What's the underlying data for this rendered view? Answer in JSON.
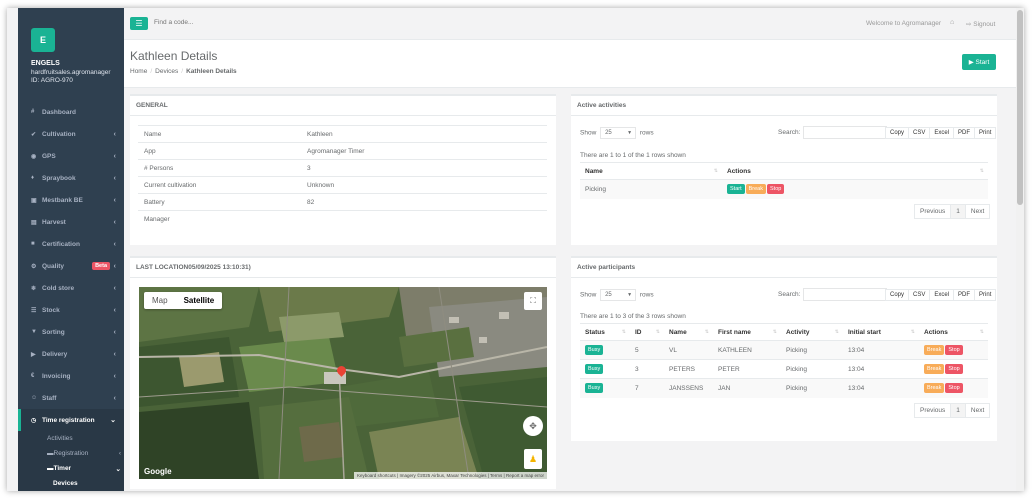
{
  "sidebar": {
    "logo": "E",
    "company": "ENGELS",
    "email": "hardfruitsales.agromanager",
    "id": "ID: AGRO-970",
    "items": [
      {
        "icon": "#",
        "label": "Dashboard"
      },
      {
        "icon": "✔",
        "label": "Cultivation"
      },
      {
        "icon": "◉",
        "label": "GPS"
      },
      {
        "icon": "♦",
        "label": "Spraybook"
      },
      {
        "icon": "▣",
        "label": "Mestbank BE"
      },
      {
        "icon": "▤",
        "label": "Harvest"
      },
      {
        "icon": "■",
        "label": "Certification"
      },
      {
        "icon": "⚙",
        "label": "Quality",
        "badge": "Beta"
      },
      {
        "icon": "❄",
        "label": "Cold store"
      },
      {
        "icon": "☰",
        "label": "Stock"
      },
      {
        "icon": "▼",
        "label": "Sorting"
      },
      {
        "icon": "▶",
        "label": "Delivery"
      },
      {
        "icon": "€",
        "label": "Invoicing"
      },
      {
        "icon": "☺",
        "label": "Staff"
      },
      {
        "icon": "◷",
        "label": "Time registration"
      }
    ],
    "sub": {
      "activities": "Activities",
      "registration": "Registration",
      "timer": "Timer",
      "devices": "Devices"
    }
  },
  "topbar": {
    "search_placeholder": "Find a code...",
    "welcome": "Welcome to Agromanager",
    "signout": "Signout"
  },
  "header": {
    "title": "Kathleen Details",
    "breadcrumb": [
      "Home",
      "Devices",
      "Kathleen Details"
    ],
    "start_label": "Start"
  },
  "general": {
    "title": "GENERAL",
    "rows": [
      {
        "key": "Name",
        "value": "Kathleen"
      },
      {
        "key": "App",
        "value": "Agromanager Timer"
      },
      {
        "key": "# Persons",
        "value": "3"
      },
      {
        "key": "Current cultivation",
        "value": "Unknown"
      },
      {
        "key": "Battery",
        "value": "82"
      },
      {
        "key": "Manager",
        "value": ""
      }
    ]
  },
  "location": {
    "title": "LAST LOCATION05/09/2025 13:10:31)",
    "map_label": "Map",
    "satellite_label": "Satellite",
    "google": "Google",
    "attribution": "Keyboard shortcuts | Imagery ©2025 Airbus, Maxar Technologies | Terms | Report a map error"
  },
  "activities": {
    "title": "Active activities",
    "show": "Show",
    "rows_label": "rows",
    "page_size": "25",
    "search_label": "Search:",
    "buttons": [
      "Copy",
      "CSV",
      "Excel",
      "PDF",
      "Print"
    ],
    "info": "There are 1 to 1 of the 1 rows shown",
    "columns": [
      "Name",
      "Actions"
    ],
    "rows": [
      {
        "name": "Picking",
        "actions": [
          "Start",
          "Break",
          "Stop"
        ]
      }
    ],
    "pager": [
      "Previous",
      "1",
      "Next"
    ]
  },
  "participants": {
    "title": "Active participants",
    "show": "Show",
    "rows_label": "rows",
    "page_size": "25",
    "search_label": "Search:",
    "buttons": [
      "Copy",
      "CSV",
      "Excel",
      "PDF",
      "Print"
    ],
    "info": "There are 1 to 3 of the 3 rows shown",
    "columns": [
      "Status",
      "ID",
      "Name",
      "First name",
      "Activity",
      "Initial start",
      "Actions"
    ],
    "rows": [
      {
        "status": "Busy",
        "id": "5",
        "name": "VL",
        "first": "KATHLEEN",
        "activity": "Picking",
        "start": "13:04",
        "actions": [
          "Break",
          "Stop"
        ]
      },
      {
        "status": "Busy",
        "id": "3",
        "name": "PETERS",
        "first": "PETER",
        "activity": "Picking",
        "start": "13:04",
        "actions": [
          "Break",
          "Stop"
        ]
      },
      {
        "status": "Busy",
        "id": "7",
        "name": "JANSSENS",
        "first": "JAN",
        "activity": "Picking",
        "start": "13:04",
        "actions": [
          "Break",
          "Stop"
        ]
      }
    ],
    "pager": [
      "Previous",
      "1",
      "Next"
    ]
  },
  "colors": {
    "accent": "#1ab394",
    "sidebar": "#2f4050",
    "danger": "#ed5565",
    "warning": "#f8ac59"
  }
}
